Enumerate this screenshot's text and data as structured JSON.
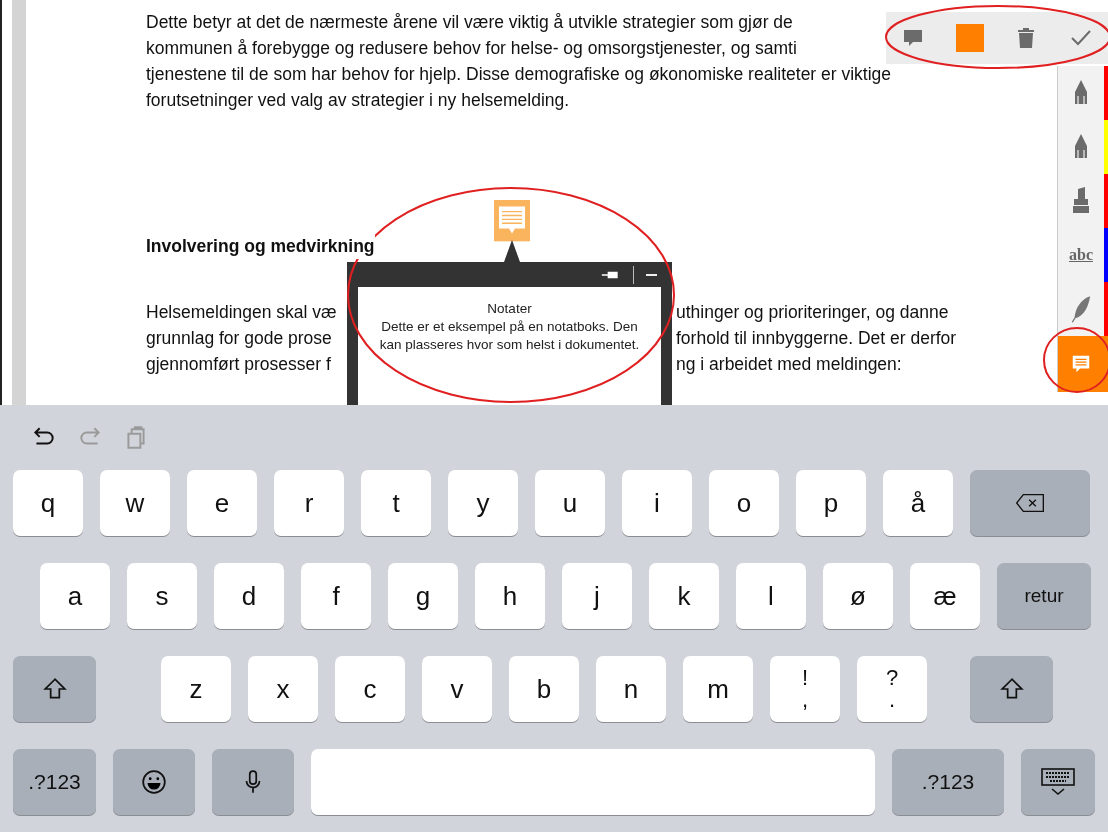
{
  "document": {
    "paragraph_1_lines": [
      "Dette betyr at det de nærmeste årene vil være viktig å utvikle strategier som gjør de",
      "kommunen å forebygge og redusere behov for helse- og omsorgstjenester, og samti",
      "tjenestene til de som har behov for hjelp. Disse demografiske og økonomiske realiteter er viktige",
      "forutsetninger ved valg av strategier i ny helsemelding."
    ],
    "heading": "Involvering og medvirkning",
    "paragraph_2_lines": [
      {
        "left": "Helsemeldingen skal væ",
        "right": "uthinger og prioriteringer, og danne"
      },
      {
        "left": "grunnlag for gode prose",
        "right": "forhold til innbyggerne. Det er derfor"
      },
      {
        "left": "gjennomført prosesser f",
        "right": "ng i arbeidet med meldingen:"
      }
    ]
  },
  "note_toolbar": {
    "color": "#ff8000"
  },
  "note_popup": {
    "title": "Notater",
    "text": "Dette er et eksempel på en notatboks. Den kan plasseres hvor som helst i dokumentet."
  },
  "tools": [
    {
      "kind": "pen",
      "color": "#ff0000",
      "selected": false
    },
    {
      "kind": "pencil",
      "color": "#ffff00",
      "selected": false
    },
    {
      "kind": "highlighter",
      "color": "#ff0000",
      "selected": false
    },
    {
      "kind": "text",
      "label": "abc",
      "color": "#0000ff",
      "selected": false
    },
    {
      "kind": "feather",
      "color": "#ff0000",
      "selected": false
    },
    {
      "kind": "note",
      "color": "#ff8000",
      "selected": true
    }
  ],
  "edit_actions": [
    {
      "kind": "undo",
      "disabled": false
    },
    {
      "kind": "redo",
      "disabled": true
    },
    {
      "kind": "paste",
      "disabled": true
    }
  ],
  "keyboard": {
    "rows": [
      [
        {
          "kind": "letter",
          "label": "q"
        },
        {
          "kind": "letter",
          "label": "w"
        },
        {
          "kind": "letter",
          "label": "e"
        },
        {
          "kind": "letter",
          "label": "r"
        },
        {
          "kind": "letter",
          "label": "t"
        },
        {
          "kind": "letter",
          "label": "y"
        },
        {
          "kind": "letter",
          "label": "u"
        },
        {
          "kind": "letter",
          "label": "i"
        },
        {
          "kind": "letter",
          "label": "o"
        },
        {
          "kind": "letter",
          "label": "p"
        },
        {
          "kind": "letter",
          "label": "å"
        },
        {
          "kind": "backspace"
        }
      ],
      [
        {
          "kind": "letter",
          "label": "a"
        },
        {
          "kind": "letter",
          "label": "s"
        },
        {
          "kind": "letter",
          "label": "d"
        },
        {
          "kind": "letter",
          "label": "f"
        },
        {
          "kind": "letter",
          "label": "g"
        },
        {
          "kind": "letter",
          "label": "h"
        },
        {
          "kind": "letter",
          "label": "j"
        },
        {
          "kind": "letter",
          "label": "k"
        },
        {
          "kind": "letter",
          "label": "l"
        },
        {
          "kind": "letter",
          "label": "ø"
        },
        {
          "kind": "letter",
          "label": "æ"
        },
        {
          "kind": "return",
          "label": "retur"
        }
      ],
      [
        {
          "kind": "shift"
        },
        {
          "kind": "letter",
          "label": "z"
        },
        {
          "kind": "letter",
          "label": "x"
        },
        {
          "kind": "letter",
          "label": "c"
        },
        {
          "kind": "letter",
          "label": "v"
        },
        {
          "kind": "letter",
          "label": "b"
        },
        {
          "kind": "letter",
          "label": "n"
        },
        {
          "kind": "letter",
          "label": "m"
        },
        {
          "kind": "dual",
          "label": "!",
          "sublabel": ","
        },
        {
          "kind": "dual",
          "label": "?",
          "sublabel": "."
        },
        {
          "kind": "shift"
        }
      ],
      [
        {
          "kind": "mode",
          "label": ".?123"
        },
        {
          "kind": "emoji"
        },
        {
          "kind": "mic"
        },
        {
          "kind": "space"
        },
        {
          "kind": "mode",
          "label": ".?123"
        },
        {
          "kind": "hide"
        }
      ]
    ]
  }
}
